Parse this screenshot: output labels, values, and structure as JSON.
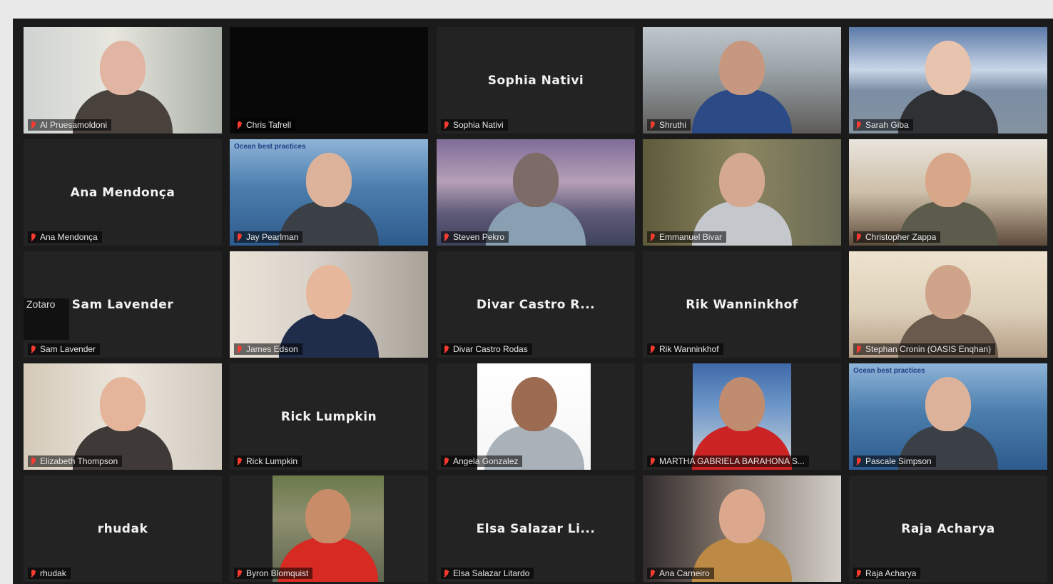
{
  "app": {
    "theme": {
      "background": "#1b1b1b",
      "tile": "#232323",
      "label_bg": "rgba(0,0,0,0.55)",
      "muted_mic": "#ff3b30"
    }
  },
  "participants": [
    {
      "name": "Al Pruesamoldoni",
      "display_name": null,
      "video": true,
      "muted": true,
      "scene": "office-light"
    },
    {
      "name": "Chris Tafrell",
      "display_name": null,
      "video": false,
      "muted": true,
      "scene": "black"
    },
    {
      "name": "Sophia Nativi",
      "display_name": "Sophia Nativi",
      "video": false,
      "muted": true
    },
    {
      "name": "Shruthi",
      "display_name": null,
      "video": true,
      "muted": true,
      "scene": "room"
    },
    {
      "name": "Sarah Giba",
      "display_name": null,
      "video": true,
      "muted": true,
      "scene": "sea-sky"
    },
    {
      "name": "Ana Mendonça",
      "display_name": "Ana Mendonça",
      "video": false,
      "muted": true
    },
    {
      "name": "Jay Pearlman",
      "display_name": null,
      "video": true,
      "muted": true,
      "scene": "ocean-logo"
    },
    {
      "name": "Steven Pekro",
      "display_name": null,
      "video": true,
      "muted": true,
      "scene": "sunset"
    },
    {
      "name": "Emmanuel Bivar",
      "display_name": null,
      "video": true,
      "muted": true,
      "scene": "tree"
    },
    {
      "name": "Christopher Zappa",
      "display_name": null,
      "video": true,
      "muted": true,
      "scene": "kitchen"
    },
    {
      "name": "Sam Lavender",
      "display_name": "Sam Lavender",
      "video": false,
      "muted": true,
      "overlay": "Zotaro"
    },
    {
      "name": "James Edson",
      "display_name": null,
      "video": true,
      "muted": true,
      "scene": "desk"
    },
    {
      "name": "Divar Castro Rodas",
      "display_name": "Divar Castro R...",
      "video": false,
      "muted": true
    },
    {
      "name": "Rik Wanninkhof",
      "display_name": "Rik Wanninkhof",
      "video": false,
      "muted": true
    },
    {
      "name": "Stephan Cronin (OASIS Enqhan)",
      "display_name": null,
      "video": true,
      "muted": true,
      "scene": "window"
    },
    {
      "name": "Elizabeth Thompson",
      "display_name": null,
      "video": true,
      "muted": true,
      "scene": "wall"
    },
    {
      "name": "Rick Lumpkin",
      "display_name": "Rick Lumpkin",
      "video": false,
      "muted": true
    },
    {
      "name": "Angela Gonzalez",
      "display_name": null,
      "video": true,
      "muted": true,
      "scene": "white"
    },
    {
      "name": "MARTHA GABRIELA BARAHONA S...",
      "display_name": null,
      "video": true,
      "muted": true,
      "scene": "boat"
    },
    {
      "name": "Pascale Simpson",
      "display_name": null,
      "video": true,
      "muted": true,
      "scene": "ocean-logo"
    },
    {
      "name": "rhudak",
      "display_name": "rhudak",
      "video": false,
      "muted": true
    },
    {
      "name": "Byron Blomquist",
      "display_name": null,
      "video": true,
      "muted": true,
      "scene": "outdoor"
    },
    {
      "name": "Elsa Salazar Litardo",
      "display_name": "Elsa Salazar Li...",
      "video": false,
      "muted": true
    },
    {
      "name": "Ana Carneiro",
      "display_name": null,
      "video": true,
      "muted": true,
      "scene": "living"
    },
    {
      "name": "Raja Acharya",
      "display_name": "Raja Acharya",
      "video": false,
      "muted": true
    }
  ],
  "logo_text": "Ocean best practices"
}
